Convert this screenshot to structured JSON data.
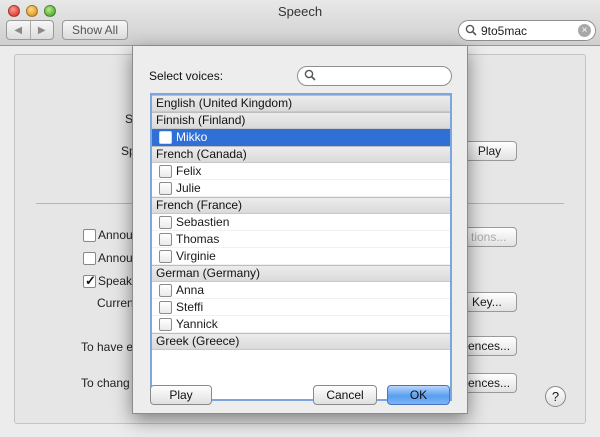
{
  "window": {
    "title": "Speech",
    "search_value": "9to5mac",
    "show_all": "Show All"
  },
  "background": {
    "s1": "S",
    "s2": "Sp",
    "play": "Play",
    "announce1": "Annou",
    "announce2": "Annou",
    "speak": "Speak",
    "current": "Curren",
    "options_btn": "tions...",
    "key_btn": "Key...",
    "to_have": "To have e",
    "prefs1": "ences...",
    "to_change": "To chang",
    "prefs2": "ences...",
    "help": "?"
  },
  "sheet": {
    "select_label": "Select voices:",
    "search_placeholder": "",
    "groups": [
      {
        "name": "English (United Kingdom)",
        "voices": []
      },
      {
        "name": "Finnish (Finland)",
        "voices": [
          {
            "name": "Mikko",
            "checked": false,
            "selected": true
          }
        ]
      },
      {
        "name": "French (Canada)",
        "voices": [
          {
            "name": "Felix",
            "checked": false
          },
          {
            "name": "Julie",
            "checked": false
          }
        ]
      },
      {
        "name": "French (France)",
        "voices": [
          {
            "name": "Sebastien",
            "checked": false
          },
          {
            "name": "Thomas",
            "checked": false
          },
          {
            "name": "Virginie",
            "checked": false
          }
        ]
      },
      {
        "name": "German (Germany)",
        "voices": [
          {
            "name": "Anna",
            "checked": false
          },
          {
            "name": "Steffi",
            "checked": false
          },
          {
            "name": "Yannick",
            "checked": false
          }
        ]
      },
      {
        "name": "Greek (Greece)",
        "voices": []
      }
    ],
    "play": "Play",
    "cancel": "Cancel",
    "ok": "OK"
  },
  "colors": {
    "selection": "#2f6fd6",
    "default_button": "#5a9ef0",
    "list_focus_ring": "#7ea6de"
  }
}
